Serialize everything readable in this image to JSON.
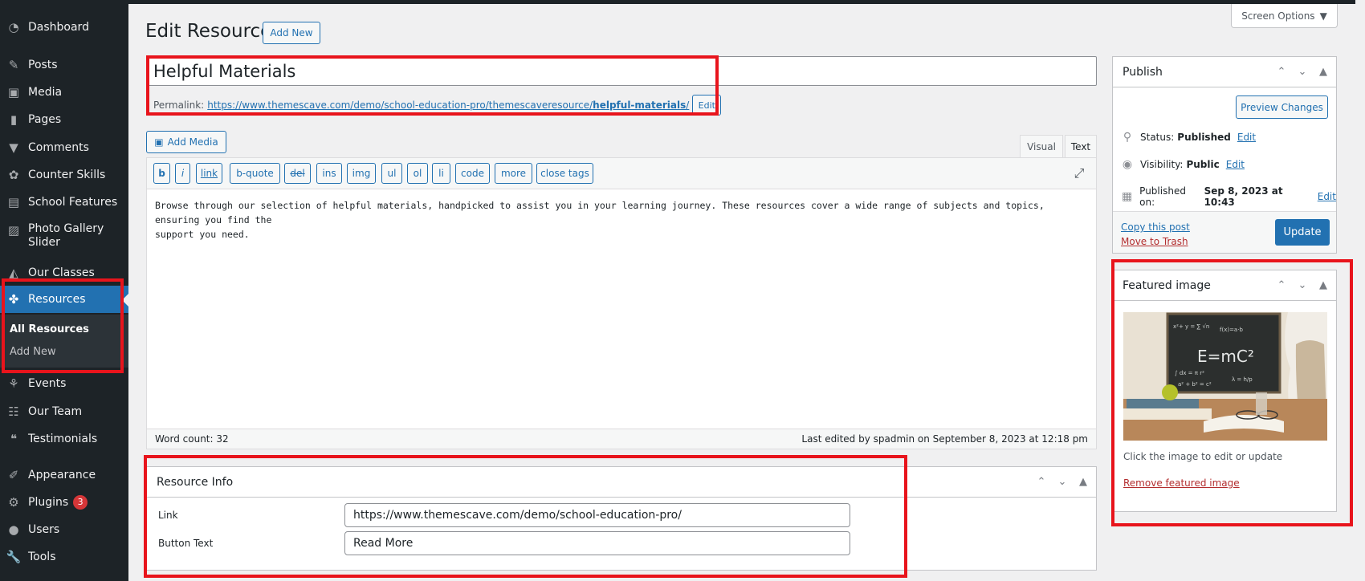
{
  "sidebar": {
    "items": [
      {
        "label": "Dashboard",
        "icon": "dashboard-icon"
      },
      {
        "label": "Posts",
        "icon": "pushpin-icon"
      },
      {
        "label": "Media",
        "icon": "media-icon"
      },
      {
        "label": "Pages",
        "icon": "page-icon"
      },
      {
        "label": "Comments",
        "icon": "comment-icon"
      },
      {
        "label": "Counter Skills",
        "icon": "palette-icon"
      },
      {
        "label": "School Features",
        "icon": "portfolio-icon"
      },
      {
        "label": "Photo Gallery",
        "label2": "Slider",
        "icon": "image-icon"
      },
      {
        "label": "Our Classes",
        "icon": "cap-icon"
      },
      {
        "label": "Resources",
        "icon": "resources-icon"
      },
      {
        "label": "Events",
        "icon": "events-icon"
      },
      {
        "label": "Our Team",
        "icon": "groups-icon"
      },
      {
        "label": "Testimonials",
        "icon": "quote-icon"
      },
      {
        "label": "Appearance",
        "icon": "brush-icon"
      },
      {
        "label": "Plugins",
        "icon": "plugin-icon",
        "badge": "3"
      },
      {
        "label": "Users",
        "icon": "user-icon"
      },
      {
        "label": "Tools",
        "icon": "wrench-icon"
      }
    ],
    "submenu": [
      "All Resources",
      "Add New"
    ]
  },
  "header": {
    "title": "Edit Resource",
    "add_new": "Add New",
    "screen_options": "Screen Options"
  },
  "post": {
    "title": "Helpful Materials",
    "permalink_label": "Permalink:",
    "permalink_base": "https://www.themescave.com/demo/school-education-pro/themescaveresource/",
    "permalink_slug": "helpful-materials",
    "permalink_trail": "/",
    "permalink_edit": "Edit"
  },
  "editor": {
    "add_media": "Add Media",
    "tab_visual": "Visual",
    "tab_text": "Text",
    "quicktags": [
      "b",
      "i",
      "link",
      "b-quote",
      "del",
      "ins",
      "img",
      "ul",
      "ol",
      "li",
      "code",
      "more",
      "close tags"
    ],
    "content_line1": "Browse through our selection of helpful materials, handpicked to assist you in your learning journey. These resources cover a wide range of subjects and topics, ensuring you find the",
    "content_line2": "support you need.",
    "word_count": "Word count: 32",
    "last_edited": "Last edited by spadmin on September 8, 2023 at 12:18 pm"
  },
  "resource_info": {
    "title": "Resource Info",
    "link_label": "Link",
    "link_value": "https://www.themescave.com/demo/school-education-pro/",
    "button_text_label": "Button Text",
    "button_text_value": "Read More"
  },
  "publish": {
    "title": "Publish",
    "preview": "Preview Changes",
    "status_label": "Status:",
    "status_value": "Published",
    "visibility_label": "Visibility:",
    "visibility_value": "Public",
    "published_label": "Published on:",
    "published_value": "Sep 8, 2023 at 10:43",
    "edit": "Edit",
    "copy_post": "Copy this post",
    "move_trash": "Move to Trash",
    "update": "Update"
  },
  "featured": {
    "title": "Featured image",
    "caption": "Click the image to edit or update",
    "remove": "Remove featured image",
    "board_formula": "E=mC²"
  },
  "colors": {
    "accent": "#2271b1",
    "highlight": "#e8141c",
    "sidebar_bg": "#1d2327",
    "danger": "#b32d2e"
  }
}
